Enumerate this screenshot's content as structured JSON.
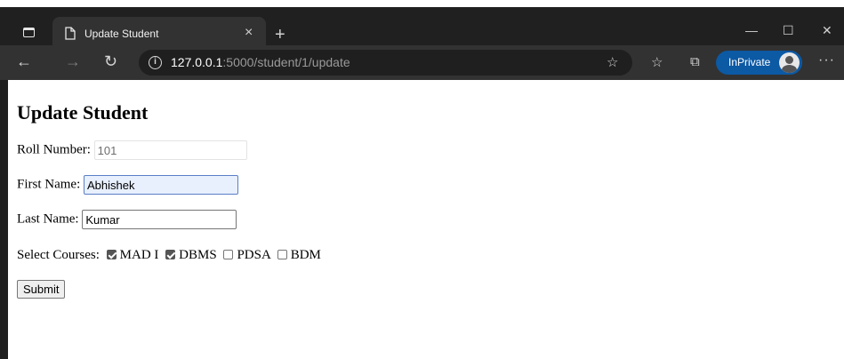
{
  "browser": {
    "tab_title": "Update Student",
    "tab_close": "×",
    "new_tab": "+",
    "url_host": "127.0.0.1",
    "url_rest": ":5000/student/1/update",
    "inprivate_label": "InPrivate",
    "more_label": "···",
    "icons": {
      "back": "back-arrow-icon",
      "forward": "forward-arrow-icon",
      "refresh": "refresh-icon",
      "info": "info-icon",
      "favorite": "add-favorite-icon",
      "favorites": "favorites-icon",
      "collections": "collections-icon"
    }
  },
  "page": {
    "heading": "Update Student",
    "roll_label": "Roll Number:",
    "roll_value": "101",
    "first_label": "First Name:",
    "first_value": "Abhishek",
    "last_label": "Last Name:",
    "last_value": "Kumar",
    "courses_label": "Select Courses:",
    "courses": [
      {
        "label": "MAD I",
        "checked": true
      },
      {
        "label": "DBMS",
        "checked": true
      },
      {
        "label": "PDSA",
        "checked": false
      },
      {
        "label": "BDM",
        "checked": false
      }
    ],
    "submit_label": "Submit"
  }
}
